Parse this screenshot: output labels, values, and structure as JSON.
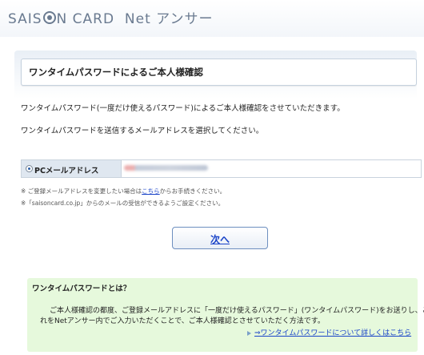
{
  "header": {
    "logo_text_1": "SAIS",
    "logo_text_2": "N CARD",
    "logo_text_3": "Net アンサー"
  },
  "title": "ワンタイムパスワードによるご本人様確認",
  "intro_1": "ワンタイムパスワード(一度だけ使えるパスワード)によるご本人様確認をさせていただきます。",
  "intro_2": "ワンタイムパスワードを送信するメールアドレスを選択してください。",
  "email_option": {
    "label": "PCメールアドレス",
    "selected": true
  },
  "notes": {
    "note_1_prefix": "※ ご登録メールアドレスを変更したい場合は",
    "note_1_link": "こちら",
    "note_1_suffix": "からお手続きください。",
    "note_2": "※「saisoncard.co.jp」からのメールの受信ができるようご設定ください。"
  },
  "next_button": "次へ",
  "info": {
    "heading": "ワンタイムパスワードとは？",
    "body_1": "ご本人様確認の都度、ご登録メールアドレスに「一度だけ使えるパスワード」(ワンタイムパスワード)をお送りし、こ",
    "body_2": "れをNetアンサー内でご入力いただくことで、ご本人様確認とさせていただく方法です。",
    "more_link": "⇒ワンタイムパスワードについて詳しくはこちら"
  }
}
